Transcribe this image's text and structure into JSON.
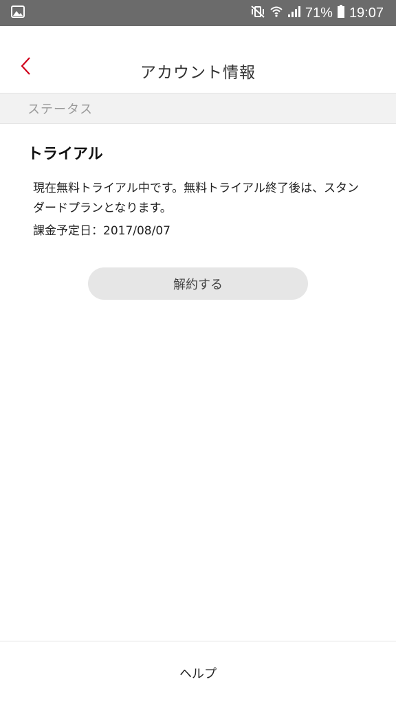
{
  "status_bar": {
    "battery": "71%",
    "time": "19:07",
    "icons": [
      "image-icon",
      "mute-vibrate-icon",
      "wifi-icon",
      "signal-icon",
      "battery-icon"
    ]
  },
  "header": {
    "title": "アカウント情報",
    "back_icon": "chevron-left-icon",
    "accent_color": "#d0021b"
  },
  "section": {
    "label": "ステータス"
  },
  "plan": {
    "name": "トライアル",
    "description": "現在無料トライアル中です。無料トライアル終了後は、スタンダードプランとなります。",
    "billing_date": "課金予定日：2017/08/07"
  },
  "actions": {
    "cancel_label": "解約する"
  },
  "footer": {
    "help_label": "ヘルプ"
  }
}
